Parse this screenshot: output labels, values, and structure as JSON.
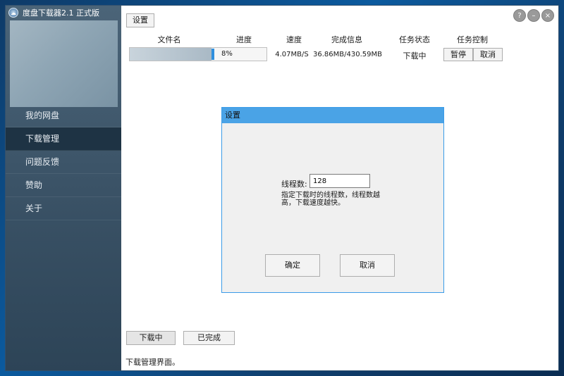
{
  "app": {
    "title": "度盘下载器2.1 正式版",
    "logo_icon": "cloud-logo-icon"
  },
  "sidebar": {
    "items": [
      {
        "label": "我的网盘"
      },
      {
        "label": "下载管理",
        "active": true
      },
      {
        "label": "问题反馈"
      },
      {
        "label": "赞助"
      },
      {
        "label": "关于"
      }
    ]
  },
  "toolbar": {
    "settings_label": "设置"
  },
  "window_controls": {
    "help": "?",
    "minimize": "–",
    "close": "×"
  },
  "table": {
    "headers": [
      "文件名",
      "进度",
      "速度",
      "完成信息",
      "任务状态",
      "任务控制"
    ],
    "rows": [
      {
        "progress_text": "8%",
        "progress_fraction": 0.08,
        "speed": "4.07MB/S",
        "done_info": "36.86MB/430.59MB",
        "status": "下载中",
        "pause_label": "暂停",
        "cancel_label": "取消"
      }
    ]
  },
  "dialog": {
    "title": "设置",
    "thread_label": "线程数:",
    "thread_value": "128",
    "hint": "指定下载时的线程数，线程数越高，下载速度越快。",
    "ok_label": "确定",
    "cancel_label": "取消"
  },
  "bottom": {
    "downloading_label": "下载中",
    "completed_label": "已完成",
    "status_text": "下载管理界面。"
  }
}
